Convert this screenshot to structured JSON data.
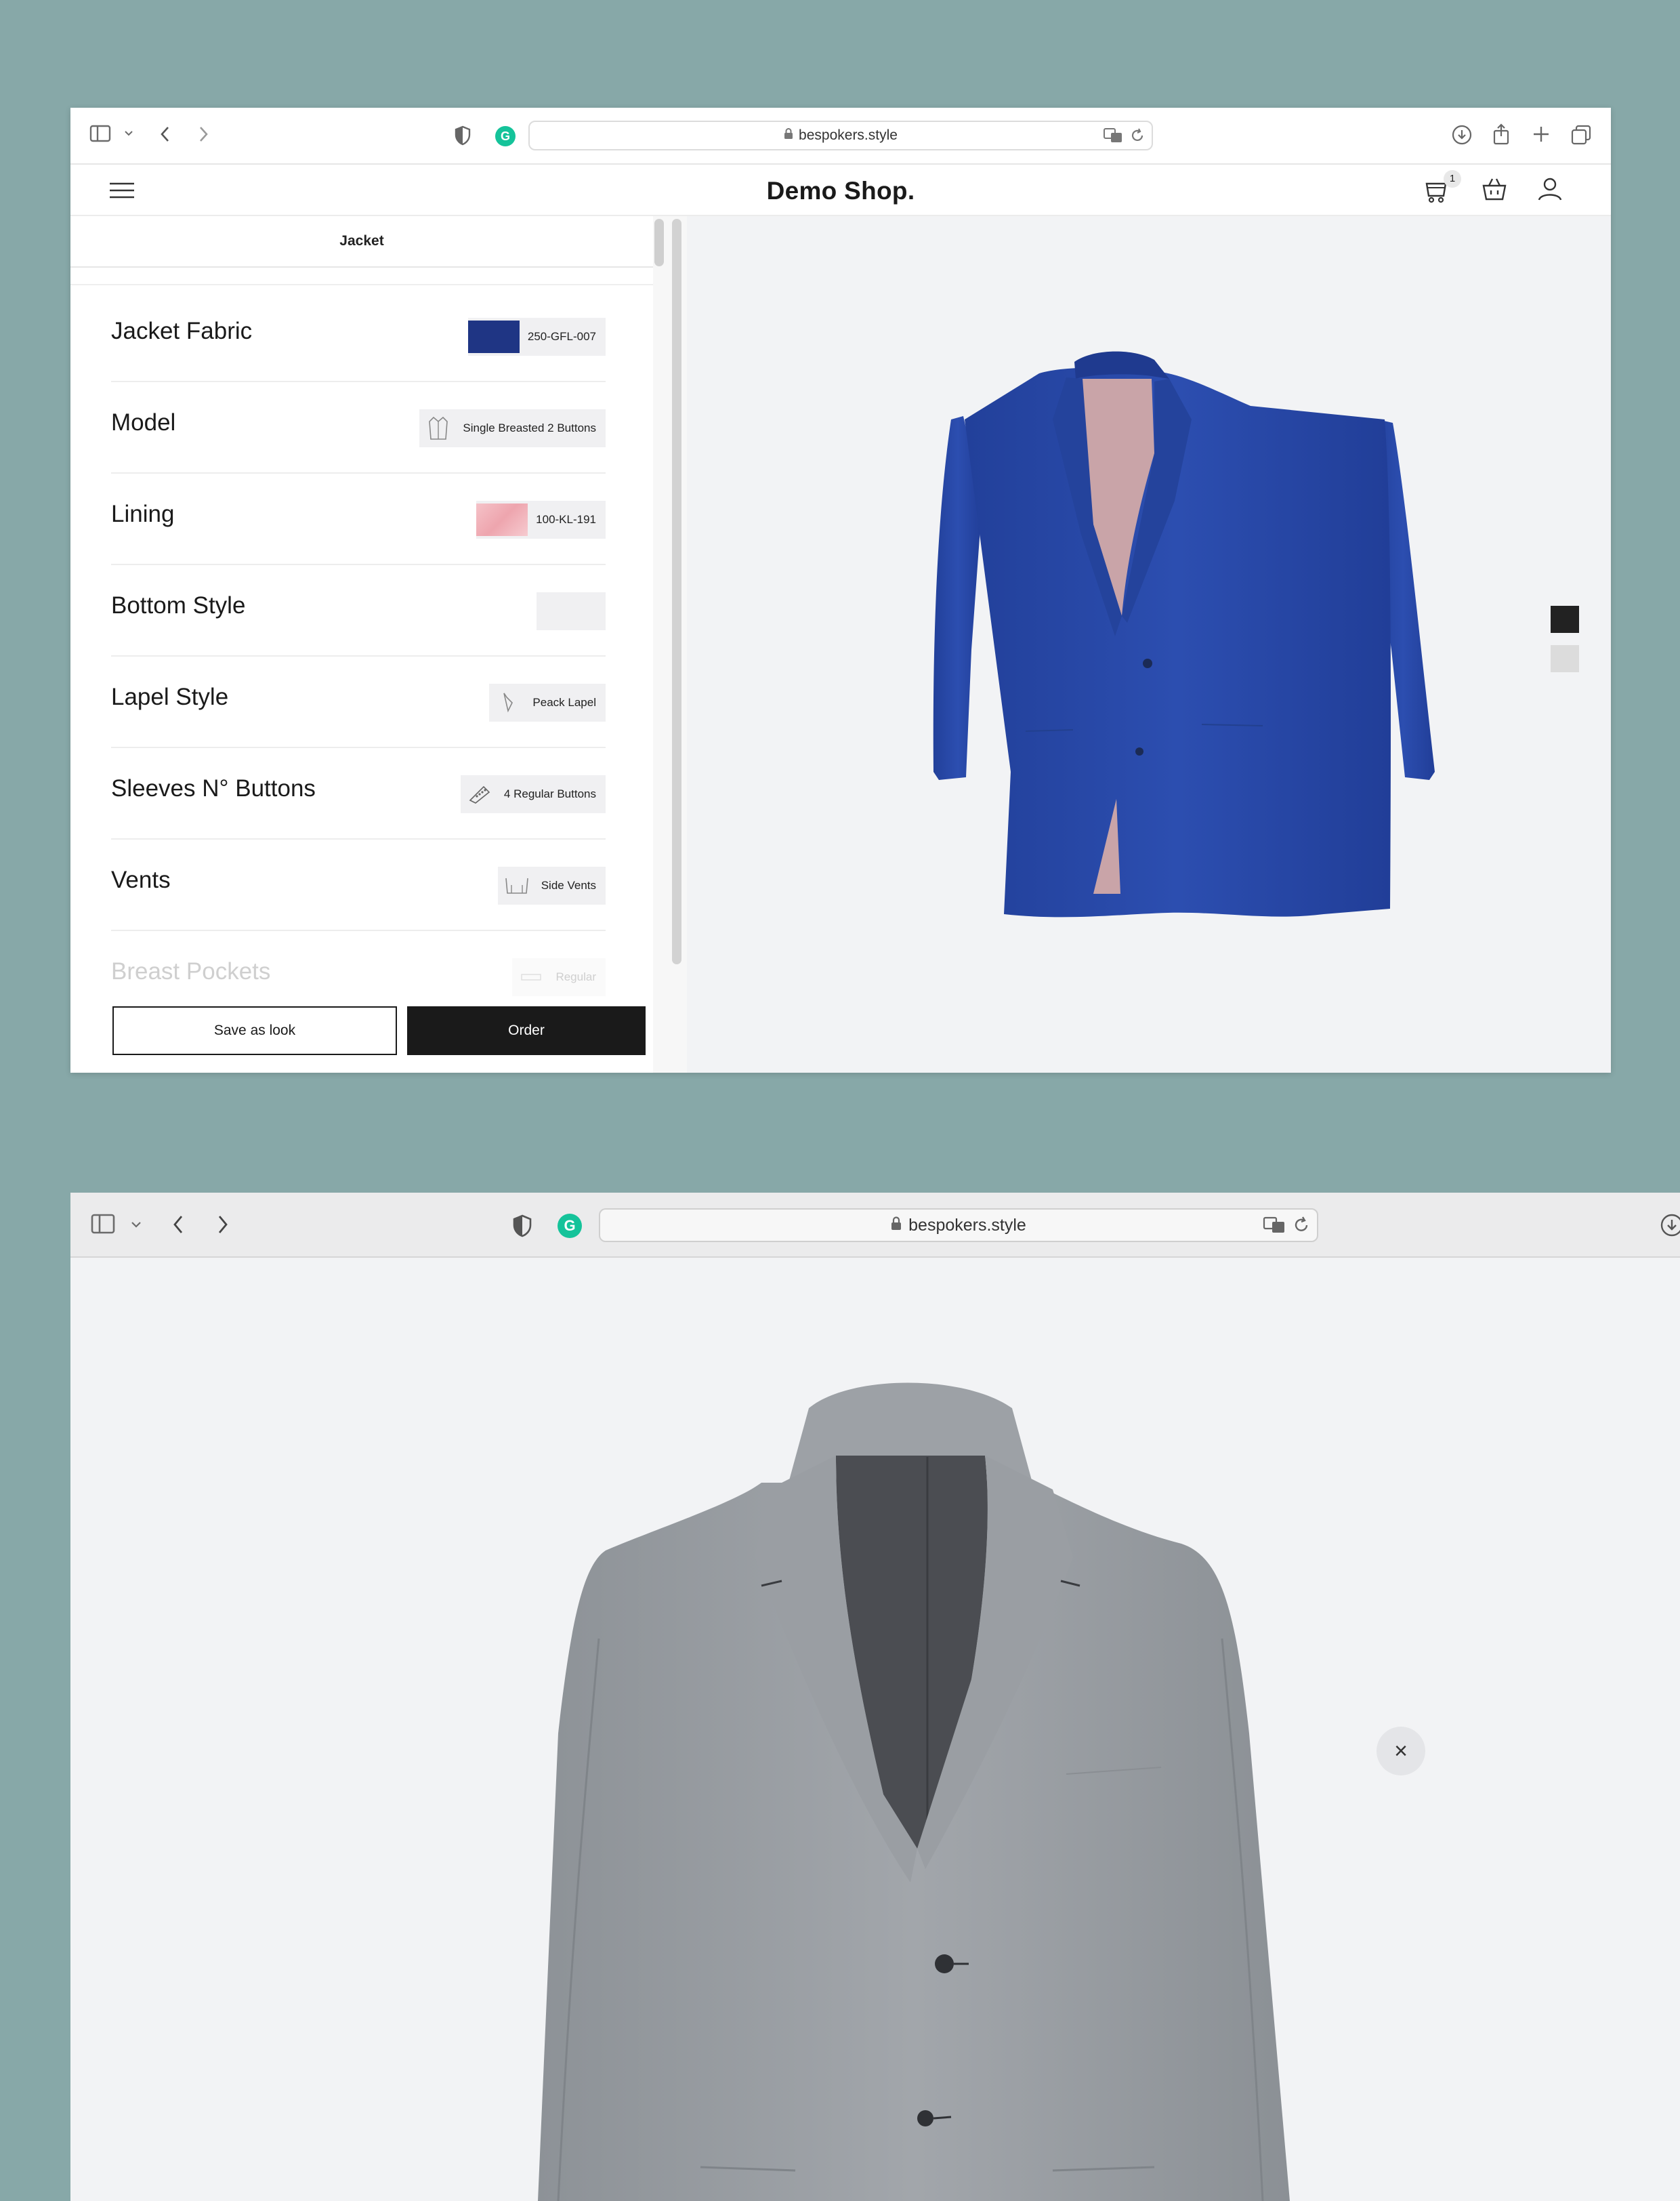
{
  "window1": {
    "url": "bespokers.style",
    "brand": "Demo Shop.",
    "cart_badge": "1",
    "panel_tab": "Jacket",
    "options": [
      {
        "label": "Jacket Fabric",
        "value": "250-GFL-007",
        "swatch": "#1f3584"
      },
      {
        "label": "Model",
        "value": "Single Breasted 2 Buttons",
        "icon": "jacket-model-icon"
      },
      {
        "label": "Lining",
        "value": "100-KL-191",
        "swatch": "#f2b6bd"
      },
      {
        "label": "Bottom Style",
        "value": ""
      },
      {
        "label": "Lapel Style",
        "value": "Peack Lapel",
        "icon": "lapel-icon"
      },
      {
        "label": "Sleeves N° Buttons",
        "value": "4 Regular Buttons",
        "icon": "sleeve-buttons-icon"
      },
      {
        "label": "Vents",
        "value": "Side Vents",
        "icon": "vents-icon"
      },
      {
        "label": "Breast Pockets",
        "value": "Regular",
        "icon": "pocket-icon"
      }
    ],
    "save_label": "Save as look",
    "order_label": "Order",
    "viewer_colors": [
      "#222222",
      "#dcdcdc"
    ],
    "jacket_color": "#2a4aa6",
    "lining_color": "#c9a4a8"
  },
  "window2": {
    "url": "bespokers.style",
    "close_label": "×",
    "jacket_color": "#9a9ea3"
  },
  "colors": {
    "background": "#87a8a8",
    "accent": "#1a1a1a"
  }
}
